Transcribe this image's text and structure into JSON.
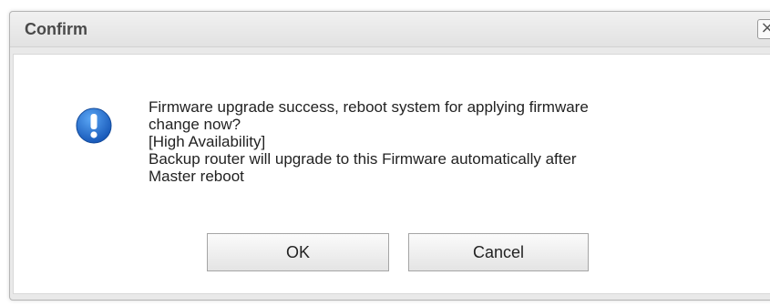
{
  "dialog": {
    "title": "Confirm",
    "close_glyph": "×",
    "icon": "info-exclamation-icon",
    "message_lines": [
      "Firmware upgrade success, reboot system for applying firmware",
      "change now?",
      "[High Availability]",
      "Backup router will upgrade to this Firmware automatically after",
      "Master reboot"
    ],
    "ok_label": "OK",
    "cancel_label": "Cancel"
  },
  "colors": {
    "icon_blue": "#1f6fd0",
    "border": "#b5b5b5"
  }
}
